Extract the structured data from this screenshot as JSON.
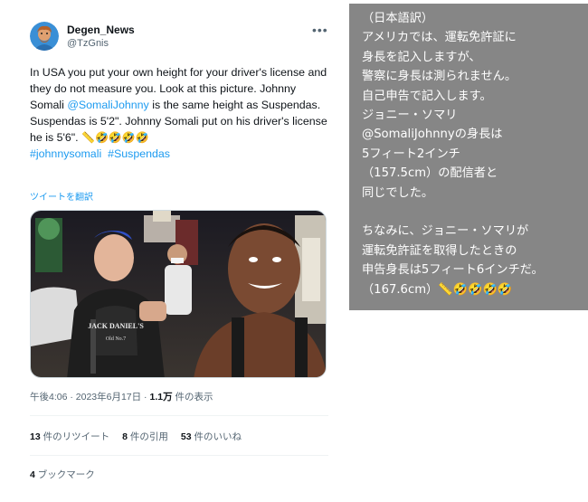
{
  "tweet": {
    "display_name": "Degen_News",
    "handle": "@TzGnis",
    "more_icon_label": "•••",
    "text_parts": {
      "p1": "In USA you put your own height for your driver's license and they do not measure you. Look at this picture. Johnny Somali ",
      "mention": "@SomaliJohnny",
      "p2": " is the same height as Suspendas. Suspendas is 5'2\". Johnny Somali put on his driver's license he is 5'6\". ",
      "emojis": "📏🤣🤣🤣🤣",
      "hashtag1": "#johnnysomali",
      "hashtag2": "#Suspendas"
    },
    "translate_link": "ツイートを翻訳",
    "meta": {
      "time_date": "午後4:06 · 2023年6月17日 · ",
      "views_count": "1.1万",
      "views_label": " 件の表示"
    },
    "stats": {
      "retweets_count": "13",
      "retweets_label": " 件のリツイート",
      "quotes_count": "8",
      "quotes_label": " 件の引用",
      "likes_count": "53",
      "likes_label": " 件のいいね"
    },
    "bookmarks": {
      "count": "4",
      "label": " ブックマーク"
    },
    "photo": {
      "shirt_text_1": "JACK DANIEL'S",
      "shirt_text_2": "Old No.7"
    }
  },
  "translation_panel": {
    "text": "（日本語訳）\nアメリカでは、運転免許証に\n身長を記入しますが、\n警察に身長は測られません。\n自己申告で記入します。\nジョニー・ソマリ\n@SomaliJohnnyの身長は\n5フィート2インチ\n（157.5cm）の配信者と\n同じでした。\n\nちなみに、ジョニー・ソマリが\n運転免許証を取得したときの\n申告身長は5フィート6インチだ。\n（167.6cm）📏🤣🤣🤣🤣"
  },
  "colors": {
    "link_blue": "#1d9bf0",
    "secondary_gray": "#536471",
    "panel_gray": "#868686"
  }
}
